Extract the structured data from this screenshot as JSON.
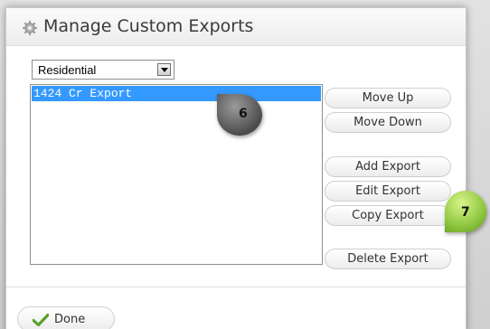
{
  "dialog": {
    "title": "Manage Custom Exports",
    "title_icon": "gear-icon"
  },
  "select": {
    "value": "Residential"
  },
  "list": {
    "items": [
      "1424 Cr Export"
    ],
    "selected_index": 0,
    "selected_color": "#3399ff"
  },
  "buttons": {
    "move_up": "Move Up",
    "move_down": "Move Down",
    "add_export": "Add Export",
    "edit_export": "Edit Export",
    "copy_export": "Copy Export",
    "delete_export": "Delete Export"
  },
  "footer": {
    "done": "Done",
    "done_icon": "check-icon"
  },
  "callouts": {
    "first": "6",
    "second": "7",
    "first_color": "#4d4d4d",
    "second_color": "#8dc63f"
  }
}
